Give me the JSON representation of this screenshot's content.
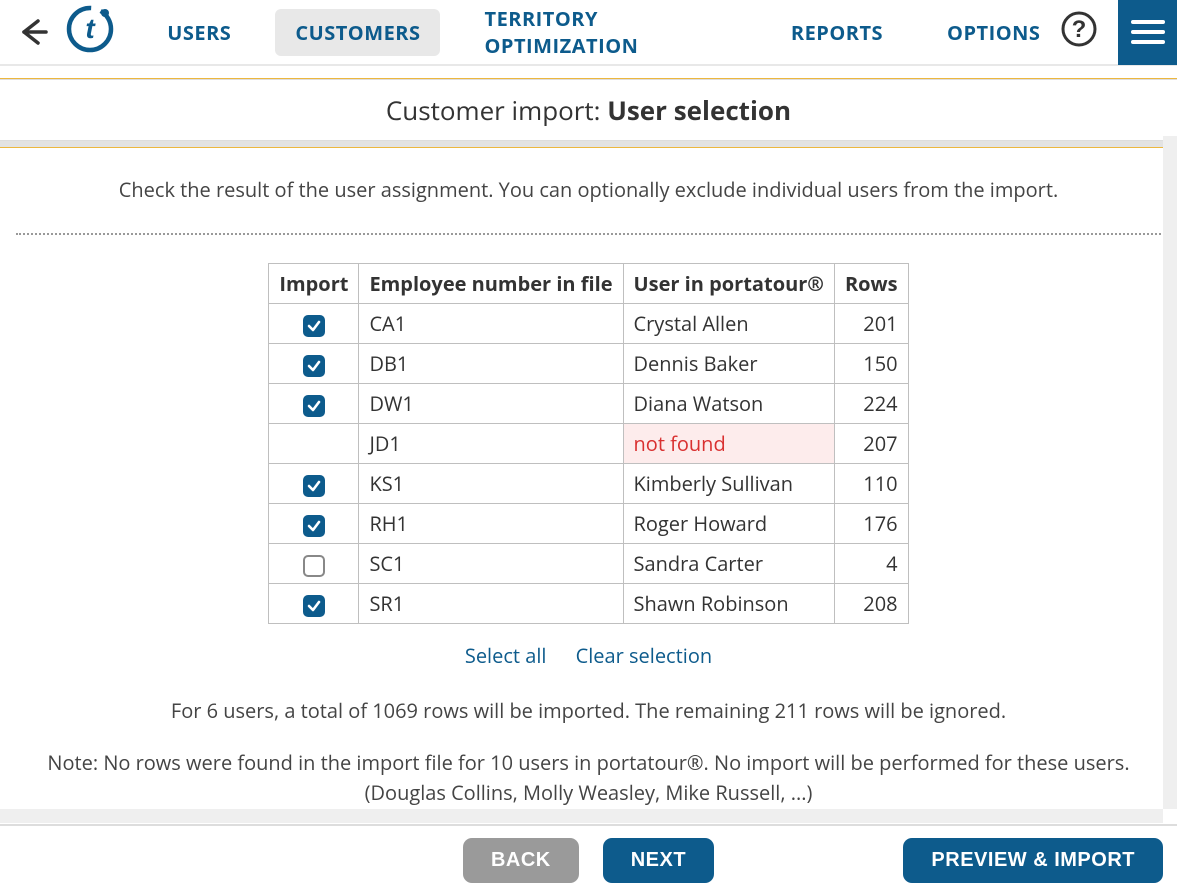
{
  "nav": {
    "users": "USERS",
    "customers": "CUSTOMERS",
    "territory": "TERRITORY OPTIMIZATION",
    "reports": "REPORTS",
    "options": "OPTIONS"
  },
  "title": {
    "prefix": "Customer import: ",
    "bold": "User selection"
  },
  "instruction": "Check the result of the user assignment. You can optionally exclude individual users from the import.",
  "table": {
    "headers": {
      "import": "Import",
      "employee": "Employee number in file",
      "user": "User in portatour®",
      "rows": "Rows"
    },
    "rows": [
      {
        "checked": true,
        "no_checkbox": false,
        "employee": "CA1",
        "user": "Crystal Allen",
        "not_found": false,
        "rows": "201"
      },
      {
        "checked": true,
        "no_checkbox": false,
        "employee": "DB1",
        "user": "Dennis Baker",
        "not_found": false,
        "rows": "150"
      },
      {
        "checked": true,
        "no_checkbox": false,
        "employee": "DW1",
        "user": "Diana Watson",
        "not_found": false,
        "rows": "224"
      },
      {
        "checked": false,
        "no_checkbox": true,
        "employee": "JD1",
        "user": "not found",
        "not_found": true,
        "rows": "207"
      },
      {
        "checked": true,
        "no_checkbox": false,
        "employee": "KS1",
        "user": "Kimberly Sullivan",
        "not_found": false,
        "rows": "110"
      },
      {
        "checked": true,
        "no_checkbox": false,
        "employee": "RH1",
        "user": "Roger Howard",
        "not_found": false,
        "rows": "176"
      },
      {
        "checked": false,
        "no_checkbox": false,
        "employee": "SC1",
        "user": "Sandra Carter",
        "not_found": false,
        "rows": "4"
      },
      {
        "checked": true,
        "no_checkbox": false,
        "employee": "SR1",
        "user": "Shawn Robinson",
        "not_found": false,
        "rows": "208"
      }
    ]
  },
  "links": {
    "select_all": "Select all",
    "clear": "Clear selection"
  },
  "summary": "For 6 users, a total of 1069 rows will be imported. The remaining 211 rows will be ignored.",
  "note_line1": "Note: No rows were found in the import file for 10 users in portatour®. No import will be performed for these users.",
  "note_line2": "(Douglas Collins, Molly Weasley, Mike Russell, ...)",
  "footer": {
    "back": "BACK",
    "next": "NEXT",
    "preview": "PREVIEW & IMPORT"
  }
}
